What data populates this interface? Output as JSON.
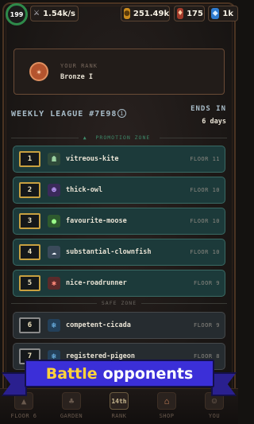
{
  "status": {
    "level": "199",
    "dps": "1.54k/s",
    "gold": "251.49k",
    "gems": "175",
    "crystals": "1k"
  },
  "rank": {
    "label": "YOUR RANK",
    "value": "Bronze I"
  },
  "league": {
    "title": "WEEKLY LEAGUE #7E98",
    "ends_label": "ENDS IN",
    "ends_value": "6 days",
    "promotion_zone": "PROMOTION ZONE",
    "safe_zone": "SAFE ZONE"
  },
  "players": [
    {
      "pos": "1",
      "name": "vitreous-kite",
      "floor": "FLOOR 11",
      "icon": "robot-icon"
    },
    {
      "pos": "2",
      "name": "thick-owl",
      "floor": "FLOOR 10",
      "icon": "demon-icon"
    },
    {
      "pos": "3",
      "name": "favourite-moose",
      "floor": "FLOOR 10",
      "icon": "slime-icon"
    },
    {
      "pos": "4",
      "name": "substantial-clownfish",
      "floor": "FLOOR 10",
      "icon": "ghost-icon"
    },
    {
      "pos": "5",
      "name": "nice-roadrunner",
      "floor": "FLOOR 9",
      "icon": "crab-icon"
    },
    {
      "pos": "6",
      "name": "competent-cicada",
      "floor": "FLOOR 9",
      "icon": "frost-icon"
    },
    {
      "pos": "7",
      "name": "registered-pigeon",
      "floor": "FLOOR 8",
      "icon": "frost-icon"
    }
  ],
  "banner": {
    "highlight": "Battle",
    "text": "opponents"
  },
  "nav": [
    {
      "label": "FLOOR 6"
    },
    {
      "label": "GARDEN"
    },
    {
      "label": "RANK",
      "badge": "14th"
    },
    {
      "label": "SHOP"
    },
    {
      "label": "YOU"
    }
  ],
  "colors": {
    "promotion_row": "#1c3a3a",
    "safe_row": "#262c30",
    "banner": "#3b2fd8",
    "banner_highlight": "#ffd23a"
  }
}
